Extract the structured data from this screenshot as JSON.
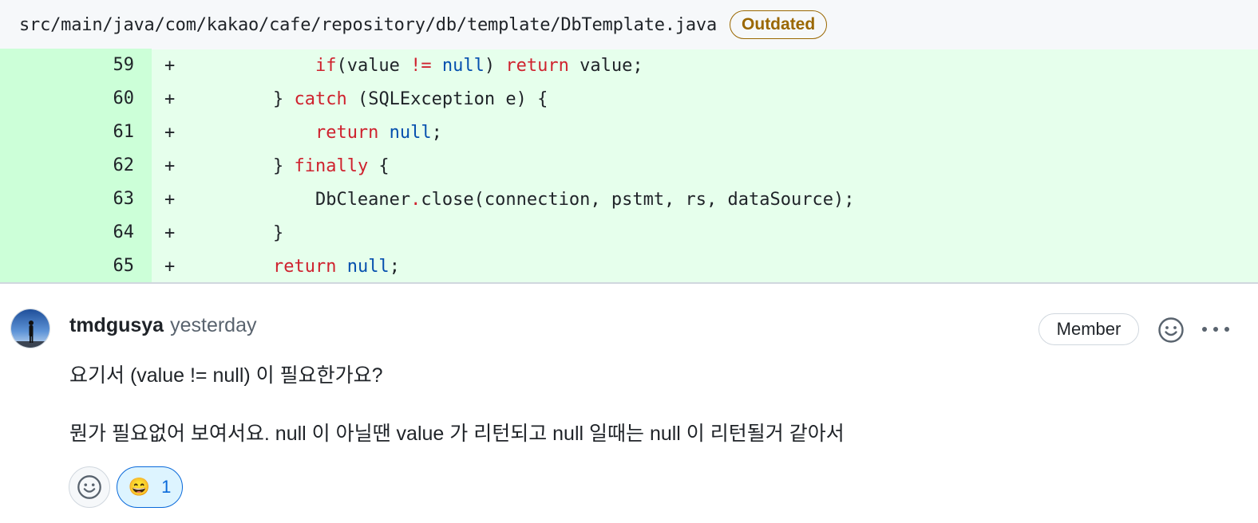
{
  "file": {
    "path": "src/main/java/com/kakao/cafe/repository/db/template/DbTemplate.java",
    "badge": "Outdated"
  },
  "diff": {
    "lines": [
      {
        "num": "59",
        "marker": "+",
        "indent": "            ",
        "tokens": [
          [
            "kw",
            "if"
          ],
          [
            "",
            "(value "
          ],
          [
            "kw",
            "!="
          ],
          [
            "",
            ""
          ],
          [
            "lit",
            " null"
          ],
          [
            "",
            ") "
          ],
          [
            "kw",
            "return"
          ],
          [
            "",
            " value;"
          ]
        ]
      },
      {
        "num": "60",
        "marker": "+",
        "indent": "        ",
        "tokens": [
          [
            "",
            "} "
          ],
          [
            "kw",
            "catch"
          ],
          [
            "",
            " (SQLException e) {"
          ]
        ]
      },
      {
        "num": "61",
        "marker": "+",
        "indent": "            ",
        "tokens": [
          [
            "kw",
            "return"
          ],
          [
            "lit",
            " null"
          ],
          [
            "",
            ";"
          ]
        ]
      },
      {
        "num": "62",
        "marker": "+",
        "indent": "        ",
        "tokens": [
          [
            "",
            "} "
          ],
          [
            "kw",
            "finally"
          ],
          [
            "",
            " {"
          ]
        ]
      },
      {
        "num": "63",
        "marker": "+",
        "indent": "            ",
        "tokens": [
          [
            "",
            "DbCleaner"
          ],
          [
            "kw",
            "."
          ],
          [
            "",
            "close(connection, pstmt, rs, dataSource);"
          ]
        ]
      },
      {
        "num": "64",
        "marker": "+",
        "indent": "        ",
        "tokens": [
          [
            "",
            "}"
          ]
        ]
      },
      {
        "num": "65",
        "marker": "+",
        "indent": "        ",
        "tokens": [
          [
            "kw",
            "return"
          ],
          [
            "lit",
            " null"
          ],
          [
            "",
            ";"
          ]
        ]
      }
    ]
  },
  "comment": {
    "author": "tmdgusya",
    "timestamp": "yesterday",
    "role_badge": "Member",
    "paragraphs": [
      "요기서 (value != null) 이 필요한가요?",
      "뭔가 필요없어 보여서요. null 이 아닐땐 value 가 리턴되고 null 일때는 null 이 리턴될거 같아서"
    ],
    "reactions": [
      {
        "emoji": "😄",
        "count": "1"
      }
    ]
  },
  "icons": {
    "add_reaction": "smiley-icon",
    "more": "kebab-horizontal-icon",
    "avatar": "user-avatar"
  },
  "colors": {
    "added_line_bg": "#e6ffec",
    "added_gutter_bg": "#ccffd8",
    "keyword": "#cf222e",
    "literal": "#0550ae",
    "outdated": "#9a6700",
    "reaction_active": "#0969da"
  }
}
